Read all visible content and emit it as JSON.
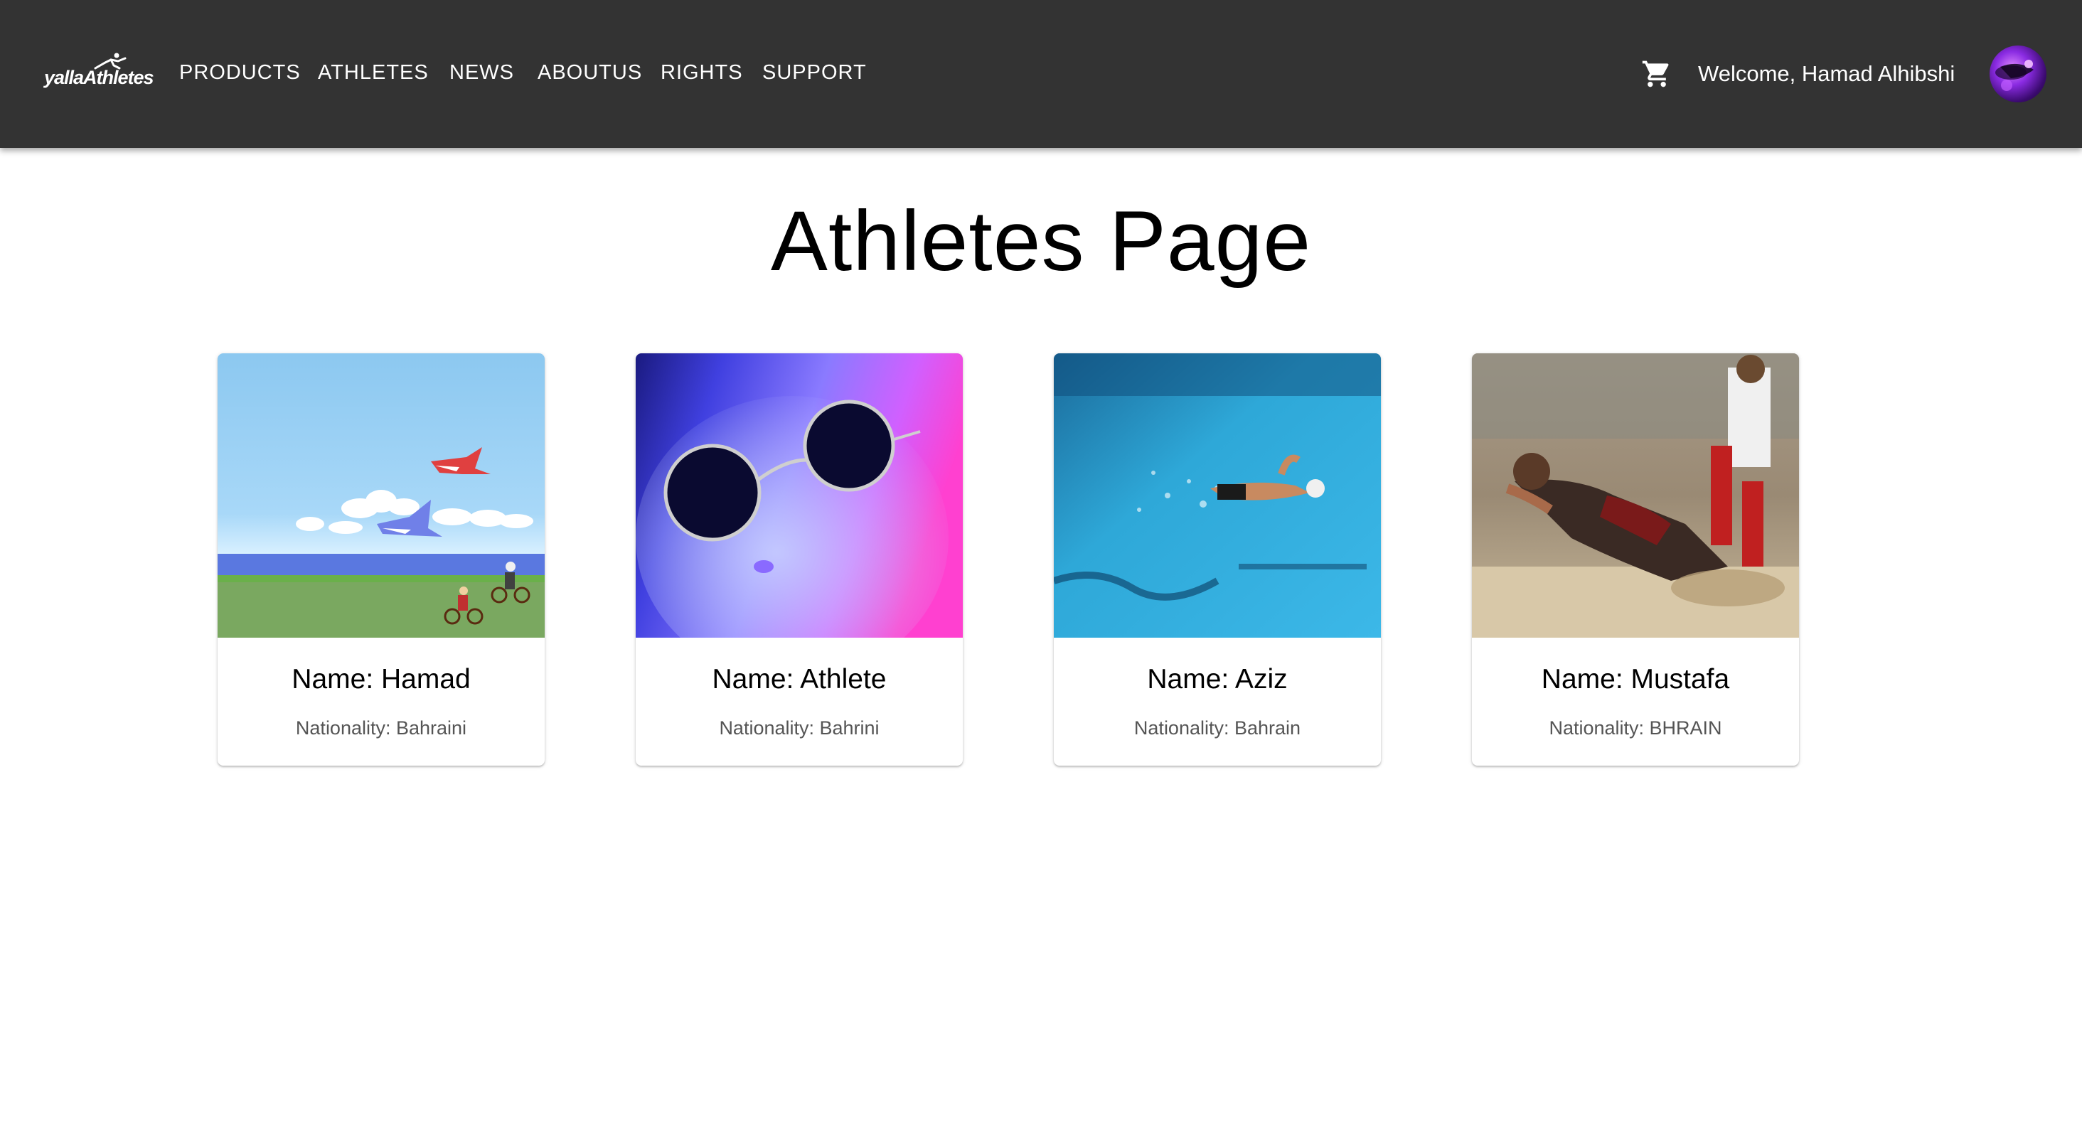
{
  "header": {
    "logo_text": "yallaAthletes",
    "nav": [
      "PRODUCTS",
      "ATHLETES",
      "NEWS",
      "ABOUTUS",
      "RIGHTS",
      "SUPPORT"
    ],
    "cart_icon": "shopping-cart-icon",
    "welcome": "Welcome, Hamad Alhibshi",
    "avatar_icon": "user-avatar"
  },
  "main": {
    "title": "Athletes Page",
    "athletes": [
      {
        "name": "Name: Hamad",
        "nationality": "Nationality: Bahraini",
        "image": "pixel-art-landscape"
      },
      {
        "name": "Name: Athlete",
        "nationality": "Nationality: Bahrini",
        "image": "cat-with-sunglasses"
      },
      {
        "name": "Name: Aziz",
        "nationality": "Nationality: Bahrain",
        "image": "swimmer-in-pool"
      },
      {
        "name": "Name: Mustafa",
        "nationality": "Nationality: BHRAIN",
        "image": "long-jumper-in-sand"
      }
    ]
  },
  "colors": {
    "appbar": "#333333",
    "text_on_appbar": "#ffffff",
    "nationality_text": "#555555"
  }
}
